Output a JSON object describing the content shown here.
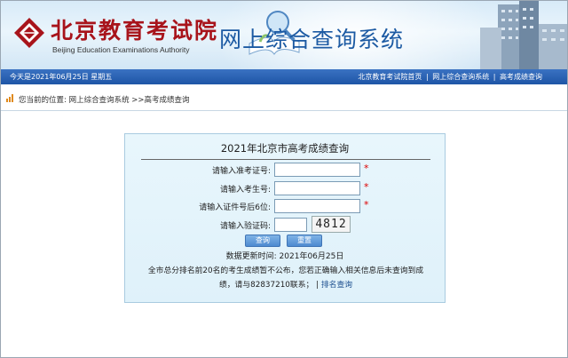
{
  "header": {
    "org_name": "北京教育考试院",
    "org_name_en": "Beijing Education Examinations Authority",
    "site_title": "网上综合查询系统"
  },
  "navbar": {
    "date_text": "今天是2021年06月25日 星期五",
    "links": [
      "北京教育考试院首页",
      "网上综合查询系统",
      "高考成绩查询"
    ],
    "separator": "|"
  },
  "breadcrumb": {
    "prefix": "您当前的位置:",
    "items": [
      "网上综合查询系统",
      " >>高考成绩查询"
    ]
  },
  "form": {
    "title": "2021年北京市高考成绩查询",
    "fields": [
      {
        "label": "请输入准考证号:",
        "value": "",
        "required": "*"
      },
      {
        "label": "请输入考生号:",
        "value": "",
        "required": "*"
      },
      {
        "label": "请输入证件号后6位:",
        "value": "",
        "required": "*"
      },
      {
        "label": "请输入验证码:",
        "value": ""
      }
    ],
    "captcha_text": "4812",
    "query_button": "查询",
    "reset_button": "重置",
    "update_time": "数据更新时间: 2021年06月25日",
    "note_line1": "全市总分排名前20名的考生成绩暂不公布，您若正确输入相关信息后未查询到成",
    "note_line2": "绩，请与82837210联系；",
    "note_sep": " | ",
    "ranking_link": "排名查询"
  },
  "colors": {
    "brand_red": "#a8141b",
    "title_blue": "#1c5aa3",
    "nav_blue": "#1e55a6",
    "required_red": "#dd0000"
  }
}
